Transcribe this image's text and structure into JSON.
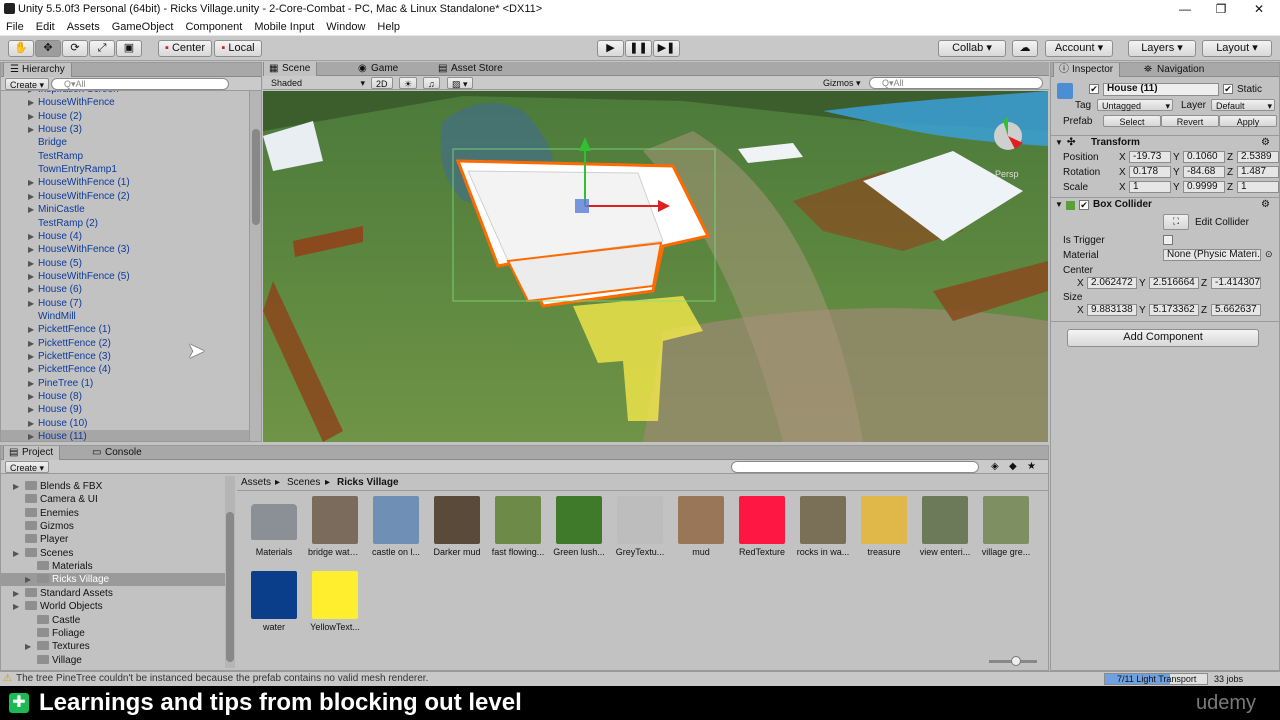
{
  "window": {
    "title": "Unity 5.5.0f3 Personal (64bit) - Ricks Village.unity - 2-Core-Combat - PC, Mac & Linux Standalone* <DX11>",
    "minimize": "—",
    "maximize": "❐",
    "close": "✕"
  },
  "menu": [
    "File",
    "Edit",
    "Assets",
    "GameObject",
    "Component",
    "Mobile Input",
    "Window",
    "Help"
  ],
  "toolbar": {
    "center": "Center",
    "local": "Local",
    "collab": "Collab ▾",
    "account": "Account",
    "layers": "Layers",
    "layout": "Layout"
  },
  "hierarchy": {
    "tab": "Hierarchy",
    "create": "Create",
    "search_placeholder": "Q▾All",
    "items": [
      {
        "label": "Inspiration Screen",
        "arrow": true
      },
      {
        "label": "HouseWithFence",
        "arrow": true
      },
      {
        "label": "House (2)",
        "arrow": true
      },
      {
        "label": "House (3)",
        "arrow": true
      },
      {
        "label": "Bridge",
        "arrow": false
      },
      {
        "label": "TestRamp",
        "arrow": false
      },
      {
        "label": "TownEntryRamp1",
        "arrow": false
      },
      {
        "label": "HouseWithFence (1)",
        "arrow": true
      },
      {
        "label": "HouseWithFence (2)",
        "arrow": true
      },
      {
        "label": "MiniCastle",
        "arrow": true
      },
      {
        "label": "TestRamp (2)",
        "arrow": false
      },
      {
        "label": "House (4)",
        "arrow": true
      },
      {
        "label": "HouseWithFence (3)",
        "arrow": true
      },
      {
        "label": "House (5)",
        "arrow": true
      },
      {
        "label": "HouseWithFence (5)",
        "arrow": true
      },
      {
        "label": "House (6)",
        "arrow": true
      },
      {
        "label": "House (7)",
        "arrow": true
      },
      {
        "label": "WindMill",
        "arrow": false
      },
      {
        "label": "PickettFence (1)",
        "arrow": true
      },
      {
        "label": "PickettFence (2)",
        "arrow": true
      },
      {
        "label": "PickettFence (3)",
        "arrow": true
      },
      {
        "label": "PickettFence (4)",
        "arrow": true
      },
      {
        "label": "PineTree (1)",
        "arrow": true
      },
      {
        "label": "House (8)",
        "arrow": true
      },
      {
        "label": "House (9)",
        "arrow": true
      },
      {
        "label": "House (10)",
        "arrow": true
      },
      {
        "label": "House (11)",
        "arrow": true
      }
    ]
  },
  "scene": {
    "tabs": [
      "Scene",
      "Game",
      "Asset Store"
    ],
    "shaded": "Shaded",
    "mode_2d": "2D",
    "gizmos": "Gizmos ▾",
    "search_placeholder": "Q▾All",
    "persp": "Persp"
  },
  "project": {
    "tabs": [
      "Project",
      "Console"
    ],
    "create": "Create",
    "tree": [
      {
        "label": "Blends & FBX",
        "level": 1,
        "arrow": true
      },
      {
        "label": "Camera & UI",
        "level": 1,
        "arrow": false
      },
      {
        "label": "Enemies",
        "level": 1,
        "arrow": false
      },
      {
        "label": "Gizmos",
        "level": 1,
        "arrow": false
      },
      {
        "label": "Player",
        "level": 1,
        "arrow": false
      },
      {
        "label": "Scenes",
        "level": 1,
        "arrow": true
      },
      {
        "label": "Materials",
        "level": 2,
        "arrow": false
      },
      {
        "label": "Ricks Village",
        "level": 2,
        "arrow": true
      },
      {
        "label": "Standard Assets",
        "level": 1,
        "arrow": true
      },
      {
        "label": "World Objects",
        "level": 1,
        "arrow": true
      },
      {
        "label": "Castle",
        "level": 2,
        "arrow": false
      },
      {
        "label": "Foliage",
        "level": 2,
        "arrow": false
      },
      {
        "label": "Textures",
        "level": 2,
        "arrow": true
      },
      {
        "label": "Village",
        "level": 2,
        "arrow": false
      }
    ],
    "breadcrumb": [
      "Assets",
      "Scenes",
      "Ricks Village"
    ],
    "assets": [
      {
        "label": "Materials",
        "color": "#8a9096"
      },
      {
        "label": "bridge wate...",
        "color": "#7a6b5c"
      },
      {
        "label": "castle on l...",
        "color": "#6f8fb5"
      },
      {
        "label": "Darker mud",
        "color": "#5a4a3a"
      },
      {
        "label": "fast flowing...",
        "color": "#6e8a48"
      },
      {
        "label": "Green lush...",
        "color": "#3f7a2a"
      },
      {
        "label": "GreyTextu...",
        "color": "#bdbdbd"
      },
      {
        "label": "mud",
        "color": "#9a7658"
      },
      {
        "label": "RedTexture",
        "color": "#ff1744"
      },
      {
        "label": "rocks in wa...",
        "color": "#7a7058"
      },
      {
        "label": "treasure",
        "color": "#e0b84a"
      },
      {
        "label": "view enteri...",
        "color": "#6d7a5a"
      },
      {
        "label": "village gre...",
        "color": "#7e8f62"
      },
      {
        "label": "water",
        "color": "#0a3d8a"
      },
      {
        "label": "YellowText...",
        "color": "#ffee2e"
      }
    ]
  },
  "inspector": {
    "tabs": [
      "Inspector",
      "Navigation"
    ],
    "name": "House (11)",
    "static": "Static",
    "tag_label": "Tag",
    "tag": "Untagged",
    "layer_label": "Layer",
    "layer": "Default",
    "prefab_label": "Prefab",
    "select": "Select",
    "revert": "Revert",
    "apply": "Apply",
    "transform": {
      "title": "Transform",
      "position": {
        "label": "Position",
        "x": "-19.73",
        "y": "0.1060",
        "z": "2.5389"
      },
      "rotation": {
        "label": "Rotation",
        "x": "0.178",
        "y": "-84.68",
        "z": "1.487"
      },
      "scale": {
        "label": "Scale",
        "x": "1",
        "y": "0.9999",
        "z": "1"
      }
    },
    "collider": {
      "title": "Box Collider",
      "edit": "Edit Collider",
      "trigger": "Is Trigger",
      "material_label": "Material",
      "material": "None (Physic Materi...",
      "center": "Center",
      "cx": "2.062472",
      "cy": "2.516664",
      "cz": "-1.414307",
      "size": "Size",
      "sx": "9.883138",
      "sy": "5.173362",
      "sz": "5.662637"
    },
    "add_component": "Add Component"
  },
  "status": {
    "message": "The tree PineTree couldn't be instanced because the prefab contains no valid mesh renderer.",
    "progress": "7/11 Light Transport",
    "jobs": "33 jobs"
  },
  "banner": {
    "text": "Learnings and tips from blocking out level",
    "brand": "udemy"
  },
  "colors": {
    "selection": "#3d6fcc",
    "highlight": "#ff6a00",
    "hierarchy_text": "#0d3b9a"
  }
}
